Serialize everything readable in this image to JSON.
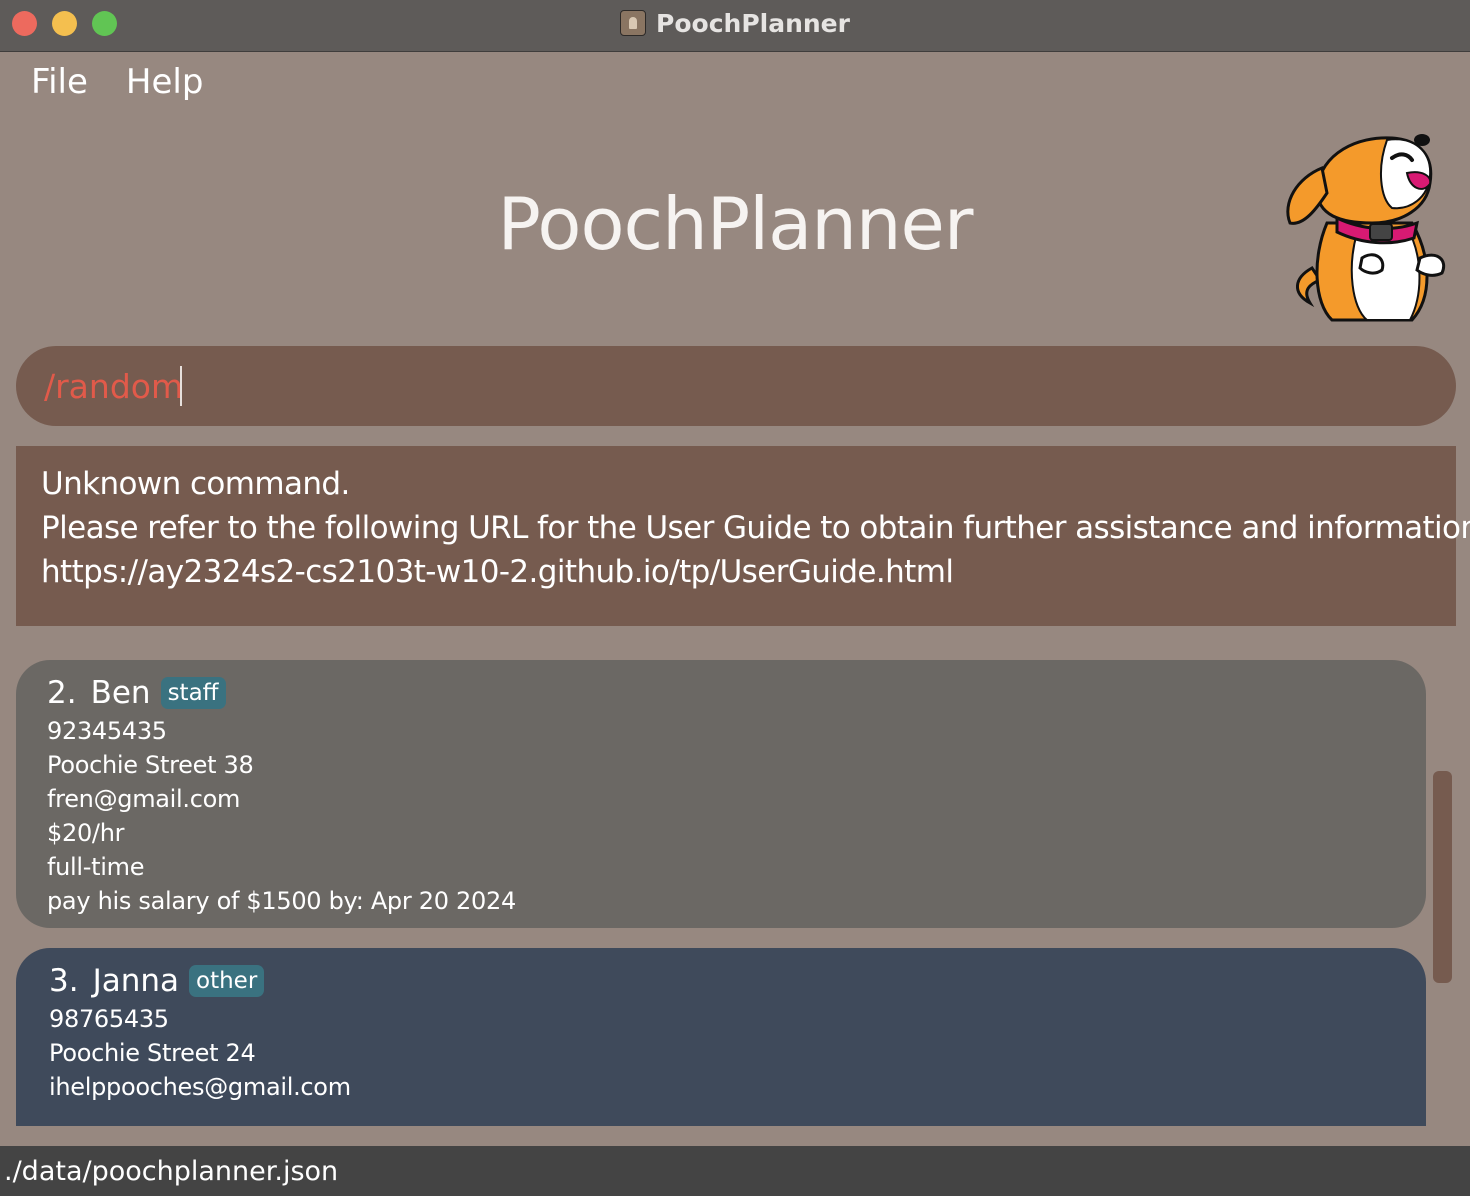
{
  "window": {
    "title": "PoochPlanner"
  },
  "menu": {
    "file": "File",
    "help": "Help"
  },
  "header": {
    "title": "PoochPlanner"
  },
  "command": {
    "value": "/random"
  },
  "result": {
    "line1": "Unknown command.",
    "line2": "Please refer to the following URL for the User Guide to obtain further assistance and information.",
    "line3": "https://ay2324s2-cs2103t-w10-2.github.io/tp/UserGuide.html"
  },
  "contacts": [
    {
      "index": "2.",
      "name": "Ben",
      "tag": "staff",
      "phone": "92345435",
      "address": "Poochie Street 38",
      "email": "fren@gmail.com",
      "salary": "$20/hr",
      "employment": "full-time",
      "note": "pay his salary of $1500 by: Apr 20 2024"
    },
    {
      "index": "3.",
      "name": "Janna",
      "tag": "other",
      "phone": "98765435",
      "address": "Poochie Street 24",
      "email": "ihelppooches@gmail.com"
    }
  ],
  "status": {
    "path": "./data/poochplanner.json"
  },
  "colors": {
    "background": "#978880",
    "command_box": "#765b4f",
    "command_text": "#e15a4a",
    "staff_card": "#6b6864",
    "other_card": "#3f4a5b",
    "tag": "#3a7280",
    "statusbar": "#444444"
  }
}
